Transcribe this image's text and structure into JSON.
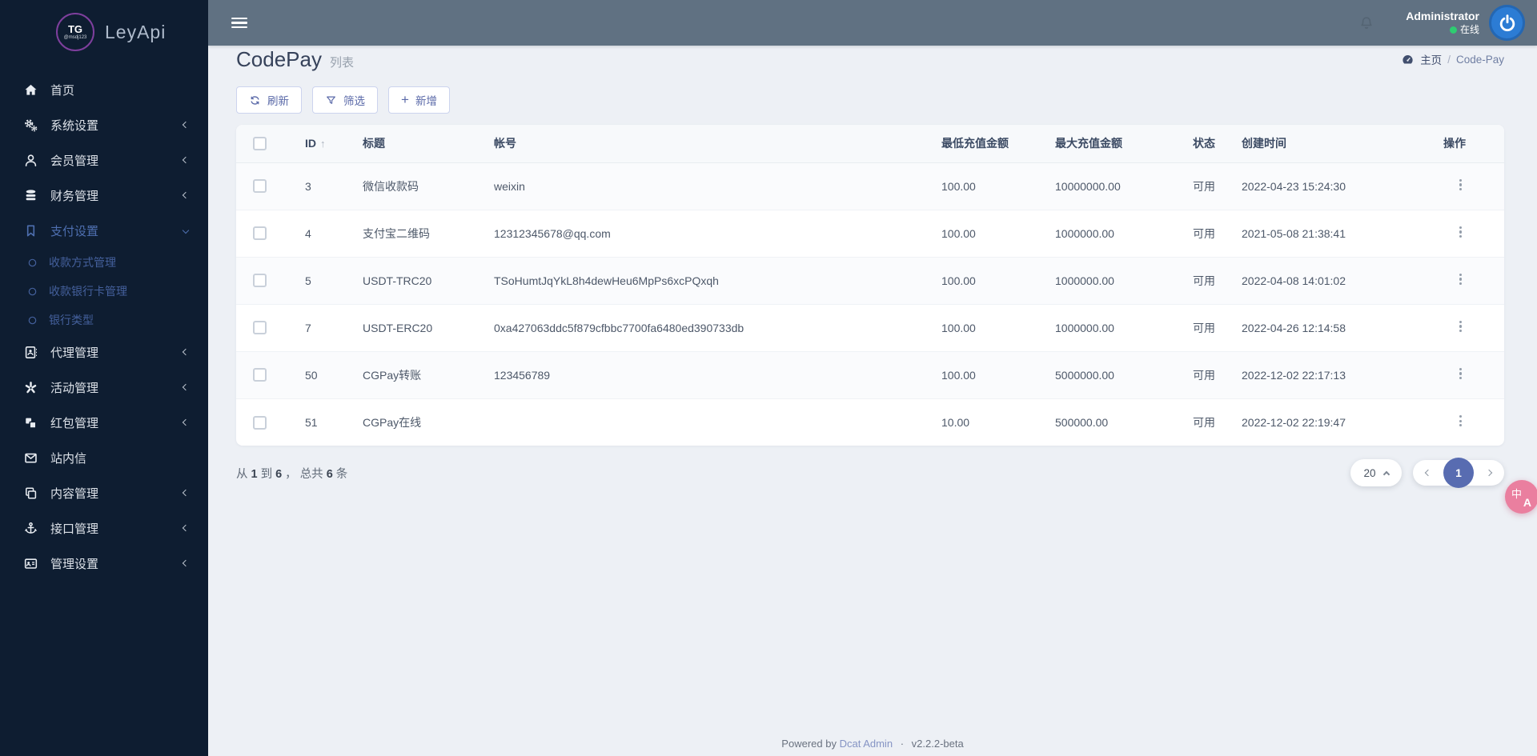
{
  "colors": {
    "accent": "#586cb1",
    "sidebar_bg": "#0e1d31",
    "navbar_bg": "#607182",
    "content_bg": "#edf0f5",
    "active_menu_blue": "#4e6fb0",
    "online_green": "#2ecc71",
    "avatar_blue": "#2c7cd4",
    "fab_pink": "#ea7f9f",
    "footer_link": "#8594c4"
  },
  "brand": {
    "logo_top": "TG",
    "logo_sub": "@msdj123",
    "title": "LeyApi"
  },
  "navbar": {
    "user_name": "Administrator",
    "user_status": "在线"
  },
  "sidebar": {
    "items": [
      {
        "key": "home",
        "label": "首页",
        "icon": "home-icon"
      },
      {
        "key": "system-settings",
        "label": "系统设置",
        "icon": "gears-icon",
        "chevron": true
      },
      {
        "key": "member-management",
        "label": "会员管理",
        "icon": "user-icon",
        "chevron": true
      },
      {
        "key": "finance-management",
        "label": "财务管理",
        "icon": "database-icon",
        "chevron": true
      },
      {
        "key": "payment-settings",
        "label": "支付设置",
        "icon": "bookmark-icon",
        "active": true,
        "expanded": true,
        "children": [
          {
            "key": "payment-method-management",
            "label": "收款方式管理"
          },
          {
            "key": "receiving-bank-card-management",
            "label": "收款银行卡管理"
          },
          {
            "key": "bank-type",
            "label": "银行类型"
          }
        ]
      },
      {
        "key": "agent-management",
        "label": "代理管理",
        "icon": "address-book-icon",
        "chevron": true
      },
      {
        "key": "activity-management",
        "label": "活动管理",
        "icon": "spark-icon",
        "chevron": true
      },
      {
        "key": "red-packet-management",
        "label": "红包管理",
        "icon": "cubes-icon",
        "chevron": true
      },
      {
        "key": "site-messages",
        "label": "站内信",
        "icon": "envelope-icon"
      },
      {
        "key": "content-management",
        "label": "内容管理",
        "icon": "clone-icon",
        "chevron": true
      },
      {
        "key": "api-management",
        "label": "接口管理",
        "icon": "anchor-icon",
        "chevron": true
      },
      {
        "key": "admin-settings",
        "label": "管理设置",
        "icon": "id-card-icon",
        "chevron": true
      }
    ]
  },
  "page": {
    "title": "CodePay",
    "subtitle": "列表",
    "breadcrumb": {
      "home": "主页",
      "separator": "/",
      "current": "Code-Pay"
    }
  },
  "toolbar": {
    "refresh": "刷新",
    "filter": "筛选",
    "add": "新增"
  },
  "table": {
    "columns": [
      "ID",
      "标题",
      "帐号",
      "最低充值金额",
      "最大充值金额",
      "状态",
      "创建时间",
      "操作"
    ],
    "rows": [
      {
        "id": "3",
        "title": "微信收款码",
        "account": "weixin",
        "min": "100.00",
        "max": "10000000.00",
        "status": "可用",
        "created": "2022-04-23 15:24:30"
      },
      {
        "id": "4",
        "title": "支付宝二维码",
        "account": "12312345678@qq.com",
        "min": "100.00",
        "max": "1000000.00",
        "status": "可用",
        "created": "2021-05-08 21:38:41"
      },
      {
        "id": "5",
        "title": "USDT-TRC20",
        "account": "TSoHumtJqYkL8h4dewHeu6MpPs6xcPQxqh",
        "min": "100.00",
        "max": "1000000.00",
        "status": "可用",
        "created": "2022-04-08 14:01:02"
      },
      {
        "id": "7",
        "title": "USDT-ERC20",
        "account": "0xa427063ddc5f879cfbbc7700fa6480ed390733db",
        "min": "100.00",
        "max": "1000000.00",
        "status": "可用",
        "created": "2022-04-26 12:14:58"
      },
      {
        "id": "50",
        "title": "CGPay转账",
        "account": "123456789",
        "min": "100.00",
        "max": "5000000.00",
        "status": "可用",
        "created": "2022-12-02 22:17:13"
      },
      {
        "id": "51",
        "title": "CGPay在线",
        "account": "",
        "min": "10.00",
        "max": "500000.00",
        "status": "可用",
        "created": "2022-12-02 22:19:47"
      }
    ]
  },
  "pagination": {
    "summary_prefix": "从",
    "from": "1",
    "to_label": "到",
    "to": "6",
    "comma": "，",
    "total_label": "总共",
    "total": "6",
    "unit": "条",
    "page_size": "20",
    "current_page": "1"
  },
  "fab": {
    "char_cn": "中",
    "char_en": "A"
  },
  "footer": {
    "powered_by": "Powered by",
    "link_label": "Dcat Admin",
    "separator": "·",
    "version": "v2.2.2-beta"
  }
}
